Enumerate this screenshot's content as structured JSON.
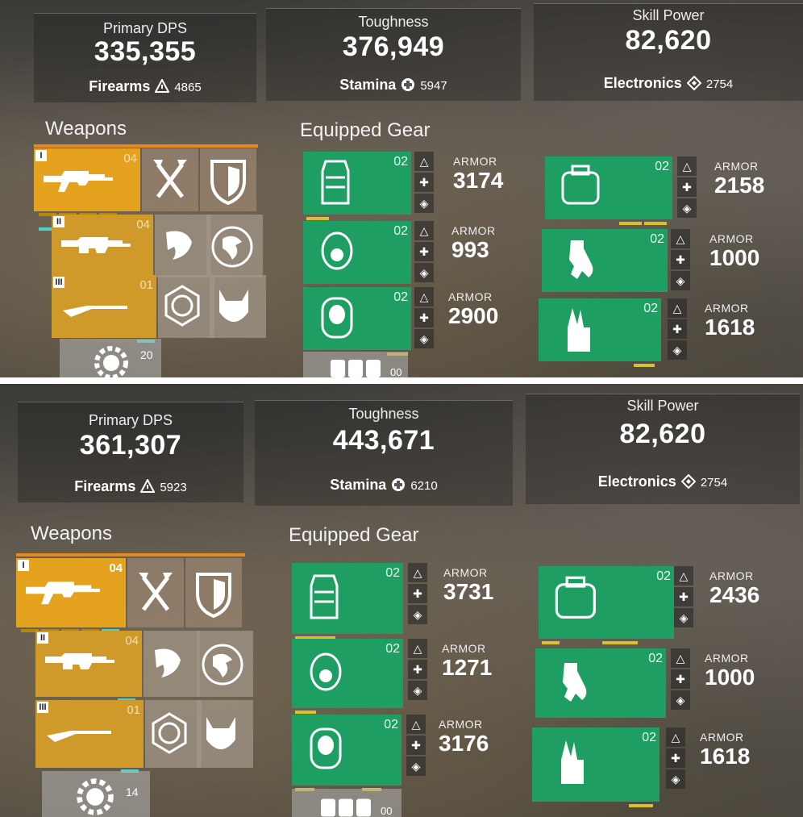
{
  "panels": [
    {
      "primary": {
        "label": "Primary DPS",
        "value": "335,355",
        "sub_label": "Firearms",
        "sub_value": "4865"
      },
      "toughness": {
        "label": "Toughness",
        "value": "376,949",
        "sub_label": "Stamina",
        "sub_value": "5947"
      },
      "skill": {
        "label": "Skill Power",
        "value": "82,620",
        "sub_label": "Electronics",
        "sub_value": "2754"
      },
      "weapons_title": "Weapons",
      "gear_title": "Equipped Gear",
      "weapons": [
        {
          "rank": "I",
          "level": "04"
        },
        {
          "rank": "II",
          "level": "04"
        },
        {
          "rank": "III",
          "level": "01"
        }
      ],
      "gear": [
        {
          "slot": "body-armor",
          "level": "02",
          "armor_label": "ARMOR",
          "armor": "3174"
        },
        {
          "slot": "backpack",
          "level": "02",
          "armor_label": "ARMOR",
          "armor": "2158"
        },
        {
          "slot": "mask",
          "level": "02",
          "armor_label": "ARMOR",
          "armor": "993"
        },
        {
          "slot": "gloves",
          "level": "02",
          "armor_label": "ARMOR",
          "armor": "1000"
        },
        {
          "slot": "kneepads",
          "level": "02",
          "armor_label": "ARMOR",
          "armor": "2900"
        },
        {
          "slot": "holster",
          "level": "02",
          "armor_label": "ARMOR",
          "armor": "1618"
        }
      ],
      "skill_mod_count": "20",
      "gear_mod_count": "00"
    },
    {
      "primary": {
        "label": "Primary DPS",
        "value": "361,307",
        "sub_label": "Firearms",
        "sub_value": "5923"
      },
      "toughness": {
        "label": "Toughness",
        "value": "443,671",
        "sub_label": "Stamina",
        "sub_value": "6210"
      },
      "skill": {
        "label": "Skill Power",
        "value": "82,620",
        "sub_label": "Electronics",
        "sub_value": "2754"
      },
      "weapons_title": "Weapons",
      "gear_title": "Equipped Gear",
      "weapons": [
        {
          "rank": "I",
          "level": "04"
        },
        {
          "rank": "II",
          "level": "04"
        },
        {
          "rank": "III",
          "level": "01"
        }
      ],
      "gear": [
        {
          "slot": "body-armor",
          "level": "02",
          "armor_label": "ARMOR",
          "armor": "3731"
        },
        {
          "slot": "backpack",
          "level": "02",
          "armor_label": "ARMOR",
          "armor": "2436"
        },
        {
          "slot": "mask",
          "level": "02",
          "armor_label": "ARMOR",
          "armor": "1271"
        },
        {
          "slot": "gloves",
          "level": "02",
          "armor_label": "ARMOR",
          "armor": "1000"
        },
        {
          "slot": "kneepads",
          "level": "02",
          "armor_label": "ARMOR",
          "armor": "3176"
        },
        {
          "slot": "holster",
          "level": "02",
          "armor_label": "ARMOR",
          "armor": "1618"
        }
      ],
      "skill_mod_count": "14",
      "gear_mod_count": "00"
    }
  ],
  "colors": {
    "weapon": "#e5a21f",
    "gear": "#1e9e63",
    "accent_teal": "#4fd1c5",
    "accent_yellow": "#d6c32a"
  }
}
